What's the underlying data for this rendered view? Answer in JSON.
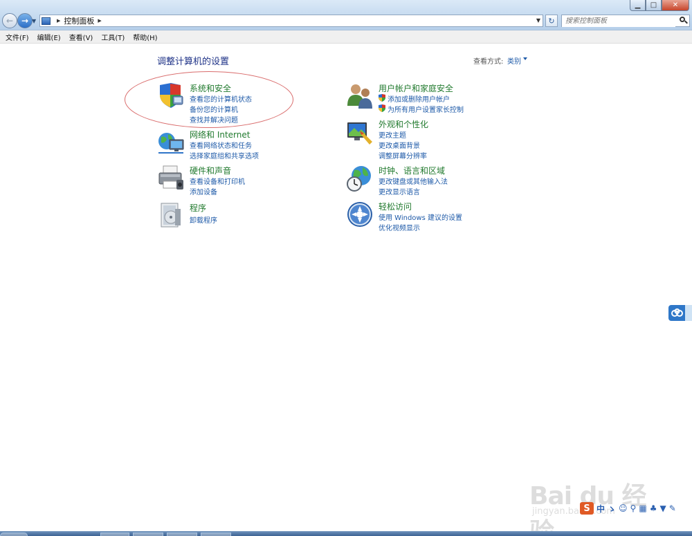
{
  "window": {
    "minimize_glyph": "▁",
    "maximize_glyph": "□",
    "close_glyph": "✕"
  },
  "nav": {
    "back_glyph": "←",
    "forward_glyph": "→",
    "dropdown_glyph": "▼",
    "refresh_glyph": "↻"
  },
  "address": {
    "breadcrumb": "控制面板",
    "separator": "▶"
  },
  "search": {
    "placeholder": "搜索控制面板"
  },
  "menu": [
    "文件(F)",
    "编辑(E)",
    "查看(V)",
    "工具(T)",
    "帮助(H)"
  ],
  "content": {
    "page_title": "调整计算机的设置",
    "view_label": "查看方式:",
    "view_value": "类别"
  },
  "categories": [
    {
      "title": "系统和安全",
      "icon": "shield-icon",
      "links": [
        "查看您的计算机状态",
        "备份您的计算机",
        "查找并解决问题"
      ]
    },
    {
      "title": "网络和 Internet",
      "icon": "network-icon",
      "links": [
        "查看网络状态和任务",
        "选择家庭组和共享选项"
      ]
    },
    {
      "title": "硬件和声音",
      "icon": "printer-icon",
      "links": [
        "查看设备和打印机",
        "添加设备"
      ]
    },
    {
      "title": "程序",
      "icon": "programs-icon",
      "links": [
        "卸载程序"
      ]
    },
    {
      "title": "用户帐户和家庭安全",
      "icon": "users-icon",
      "links": [
        "添加或删除用户帐户",
        "为所有用户设置家长控制"
      ]
    },
    {
      "title": "外观和个性化",
      "icon": "display-icon",
      "links": [
        "更改主题",
        "更改桌面背景",
        "调整屏幕分辨率"
      ]
    },
    {
      "title": "时钟、语言和区域",
      "icon": "globe-clock-icon",
      "links": [
        "更改键盘或其他输入法",
        "更改显示语言"
      ]
    },
    {
      "title": "轻松访问",
      "icon": "accessibility-icon",
      "links": [
        "使用 Windows 建议的设置",
        "优化视频显示"
      ]
    }
  ],
  "watermark": {
    "logo": "Bai du 经验",
    "sub": "jingyan.baidu.com"
  },
  "ime": {
    "logo": "S",
    "glyphs": [
      "中",
      "ゝ",
      "☺",
      "⚲",
      "▦",
      "♣",
      "▼",
      "✎"
    ]
  },
  "colors": {
    "category_title": "#217a2e",
    "link": "#1e5aa8",
    "page_title": "#1e3287",
    "annotation": "#d96b6b"
  }
}
